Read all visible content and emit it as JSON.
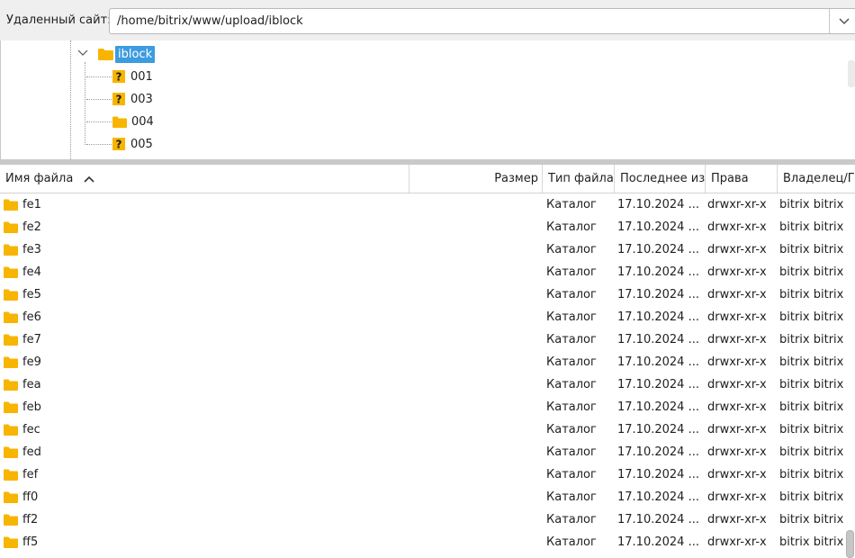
{
  "remote_site": {
    "label": "Удаленный сайт:",
    "path": "/home/bitrix/www/upload/iblock"
  },
  "tree": {
    "selected": "iblock",
    "children": [
      {
        "name": "001",
        "icon": "unknown-folder-icon"
      },
      {
        "name": "003",
        "icon": "unknown-folder-icon"
      },
      {
        "name": "004",
        "icon": "folder-icon"
      },
      {
        "name": "005",
        "icon": "unknown-folder-icon"
      }
    ]
  },
  "columns": {
    "name": "Имя файла",
    "size": "Размер",
    "type": "Тип файла",
    "modified": "Последнее изм",
    "perms": "Права",
    "owner": "Владелец/Гр"
  },
  "files": [
    {
      "name": "fe1",
      "type": "Каталог",
      "modified": "17.10.2024 ...",
      "perms": "drwxr-xr-x",
      "owner": "bitrix bitrix"
    },
    {
      "name": "fe2",
      "type": "Каталог",
      "modified": "17.10.2024 ...",
      "perms": "drwxr-xr-x",
      "owner": "bitrix bitrix"
    },
    {
      "name": "fe3",
      "type": "Каталог",
      "modified": "17.10.2024 ...",
      "perms": "drwxr-xr-x",
      "owner": "bitrix bitrix"
    },
    {
      "name": "fe4",
      "type": "Каталог",
      "modified": "17.10.2024 ...",
      "perms": "drwxr-xr-x",
      "owner": "bitrix bitrix"
    },
    {
      "name": "fe5",
      "type": "Каталог",
      "modified": "17.10.2024 ...",
      "perms": "drwxr-xr-x",
      "owner": "bitrix bitrix"
    },
    {
      "name": "fe6",
      "type": "Каталог",
      "modified": "17.10.2024 ...",
      "perms": "drwxr-xr-x",
      "owner": "bitrix bitrix"
    },
    {
      "name": "fe7",
      "type": "Каталог",
      "modified": "17.10.2024 ...",
      "perms": "drwxr-xr-x",
      "owner": "bitrix bitrix"
    },
    {
      "name": "fe9",
      "type": "Каталог",
      "modified": "17.10.2024 ...",
      "perms": "drwxr-xr-x",
      "owner": "bitrix bitrix"
    },
    {
      "name": "fea",
      "type": "Каталог",
      "modified": "17.10.2024 ...",
      "perms": "drwxr-xr-x",
      "owner": "bitrix bitrix"
    },
    {
      "name": "feb",
      "type": "Каталог",
      "modified": "17.10.2024 ...",
      "perms": "drwxr-xr-x",
      "owner": "bitrix bitrix"
    },
    {
      "name": "fec",
      "type": "Каталог",
      "modified": "17.10.2024 ...",
      "perms": "drwxr-xr-x",
      "owner": "bitrix bitrix"
    },
    {
      "name": "fed",
      "type": "Каталог",
      "modified": "17.10.2024 ...",
      "perms": "drwxr-xr-x",
      "owner": "bitrix bitrix"
    },
    {
      "name": "fef",
      "type": "Каталог",
      "modified": "17.10.2024 ...",
      "perms": "drwxr-xr-x",
      "owner": "bitrix bitrix"
    },
    {
      "name": "ff0",
      "type": "Каталог",
      "modified": "17.10.2024 ...",
      "perms": "drwxr-xr-x",
      "owner": "bitrix bitrix"
    },
    {
      "name": "ff2",
      "type": "Каталог",
      "modified": "17.10.2024 ...",
      "perms": "drwxr-xr-x",
      "owner": "bitrix bitrix"
    },
    {
      "name": "ff5",
      "type": "Каталог",
      "modified": "17.10.2024 ...",
      "perms": "drwxr-xr-x",
      "owner": "bitrix bitrix"
    }
  ],
  "colors": {
    "selection": "#3d9be0",
    "folder": "#f7b500"
  }
}
